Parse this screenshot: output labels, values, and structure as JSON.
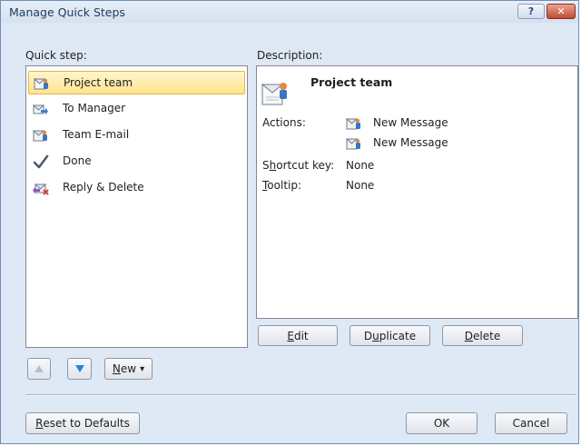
{
  "window": {
    "title": "Manage Quick Steps",
    "help_glyph": "?",
    "close_glyph": "✕"
  },
  "quick_steps": {
    "label": "Quick step:",
    "items": [
      {
        "label": "Project team",
        "icon": "team-email-icon",
        "selected": true
      },
      {
        "label": "To Manager",
        "icon": "forward-to-manager-icon",
        "selected": false
      },
      {
        "label": "Team E-mail",
        "icon": "team-email-icon",
        "selected": false
      },
      {
        "label": "Done",
        "icon": "checkmark-icon",
        "selected": false
      },
      {
        "label": "Reply & Delete",
        "icon": "reply-delete-icon",
        "selected": false
      }
    ],
    "move_up_icon": "arrow-up-icon",
    "move_down_icon": "arrow-down-icon",
    "new_button": {
      "prefix": "",
      "accel": "N",
      "suffix": "ew",
      "arrow": "▾"
    }
  },
  "description": {
    "label": "Description:",
    "name": "Project team",
    "actions_label": "Actions:",
    "actions": [
      "New Message",
      "New Message"
    ],
    "shortcut_label": {
      "prefix": "S",
      "accel": "h",
      "suffix": "ortcut key:"
    },
    "shortcut_value": "None",
    "tooltip_label": {
      "prefix": "",
      "accel": "T",
      "suffix": "ooltip:"
    },
    "tooltip_value": "None"
  },
  "desc_buttons": {
    "edit": {
      "prefix": "",
      "accel": "E",
      "suffix": "dit"
    },
    "duplicate": {
      "prefix": "D",
      "accel": "u",
      "suffix": "plicate"
    },
    "delete": {
      "prefix": "",
      "accel": "D",
      "suffix": "elete"
    }
  },
  "footer": {
    "reset": {
      "prefix": "",
      "accel": "R",
      "suffix": "eset to Defaults"
    },
    "ok": "OK",
    "cancel": "Cancel"
  },
  "colors": {
    "selection_fill": "#ffe38e",
    "selection_border": "#e3b74c",
    "dialog_bg": "#dfe8f5"
  }
}
